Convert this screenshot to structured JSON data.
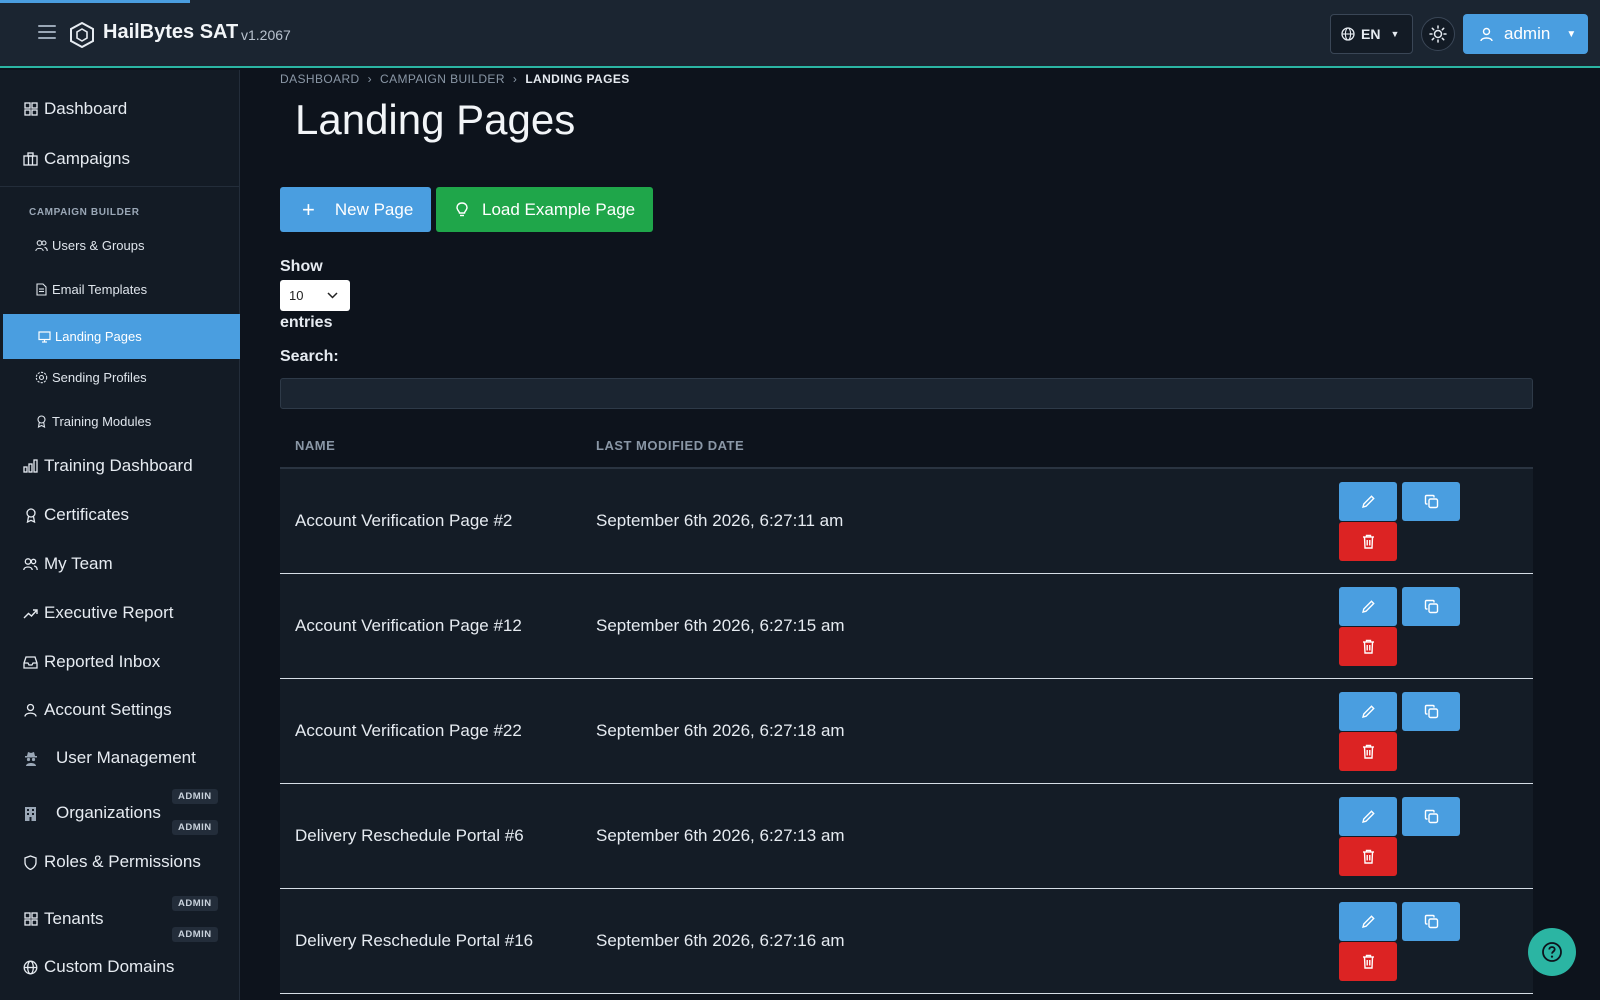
{
  "header": {
    "brand_name": "HailBytes SAT",
    "version": "v1.2067",
    "language": "EN",
    "user_label": "admin",
    "icons": [
      "menu-icon",
      "hexagon-logo-icon",
      "globe-icon",
      "sun-icon",
      "user-icon"
    ]
  },
  "sidebar": {
    "items_top": [
      {
        "label": "Dashboard",
        "icon": "grid-icon"
      },
      {
        "label": "Campaigns",
        "icon": "briefcase-icon"
      }
    ],
    "section_label": "CAMPAIGN BUILDER",
    "builder_items": [
      {
        "label": "Users & Groups",
        "icon": "users-icon"
      },
      {
        "label": "Email Templates",
        "icon": "document-icon"
      },
      {
        "label": "Landing Pages",
        "icon": "monitor-icon",
        "active": true
      },
      {
        "label": "Sending Profiles",
        "icon": "gear-icon"
      },
      {
        "label": "Training Modules",
        "icon": "award-icon"
      }
    ],
    "items_bottom": [
      {
        "label": "Training Dashboard",
        "icon": "bar-chart-icon"
      },
      {
        "label": "Certificates",
        "icon": "award-icon"
      },
      {
        "label": "My Team",
        "icon": "users-icon"
      },
      {
        "label": "Executive Report",
        "icon": "trending-up-icon"
      },
      {
        "label": "Reported Inbox",
        "icon": "inbox-icon"
      },
      {
        "label": "Account Settings",
        "icon": "user-icon"
      },
      {
        "label": "User Management",
        "icon": "spy-icon",
        "badge": "ADMIN"
      },
      {
        "label": "Organizations",
        "icon": "building-icon",
        "badge": "ADMIN"
      },
      {
        "label": "Roles & Permissions",
        "icon": "shield-icon",
        "badge": "ADMIN"
      },
      {
        "label": "Tenants",
        "icon": "grid-icon",
        "badge": "ADMIN"
      },
      {
        "label": "Custom Domains",
        "icon": "globe-icon"
      }
    ]
  },
  "breadcrumb": [
    "DASHBOARD",
    "CAMPAIGN BUILDER",
    "LANDING PAGES"
  ],
  "page_title": "Landing Pages",
  "buttons": {
    "new_page": "New Page",
    "load_example": "Load Example Page"
  },
  "table_controls": {
    "show_label": "Show",
    "entries_value": "10",
    "entries_label": "entries",
    "search_label": "Search:",
    "search_value": ""
  },
  "table": {
    "columns": [
      "NAME",
      "LAST MODIFIED DATE"
    ],
    "rows": [
      {
        "name": "Account Verification Page #2",
        "modified": "September 6th 2026, 6:27:11 am"
      },
      {
        "name": "Account Verification Page #12",
        "modified": "September 6th 2026, 6:27:15 am"
      },
      {
        "name": "Account Verification Page #22",
        "modified": "September 6th 2026, 6:27:18 am"
      },
      {
        "name": "Delivery Reschedule Portal #6",
        "modified": "September 6th 2026, 6:27:13 am"
      },
      {
        "name": "Delivery Reschedule Portal #16",
        "modified": "September 6th 2026, 6:27:16 am"
      }
    ]
  },
  "colors": {
    "accent": "#4a9ee0",
    "success": "#1fa64a",
    "danger": "#dc2323",
    "teal": "#2bb5a3",
    "background": "#0d131c"
  }
}
